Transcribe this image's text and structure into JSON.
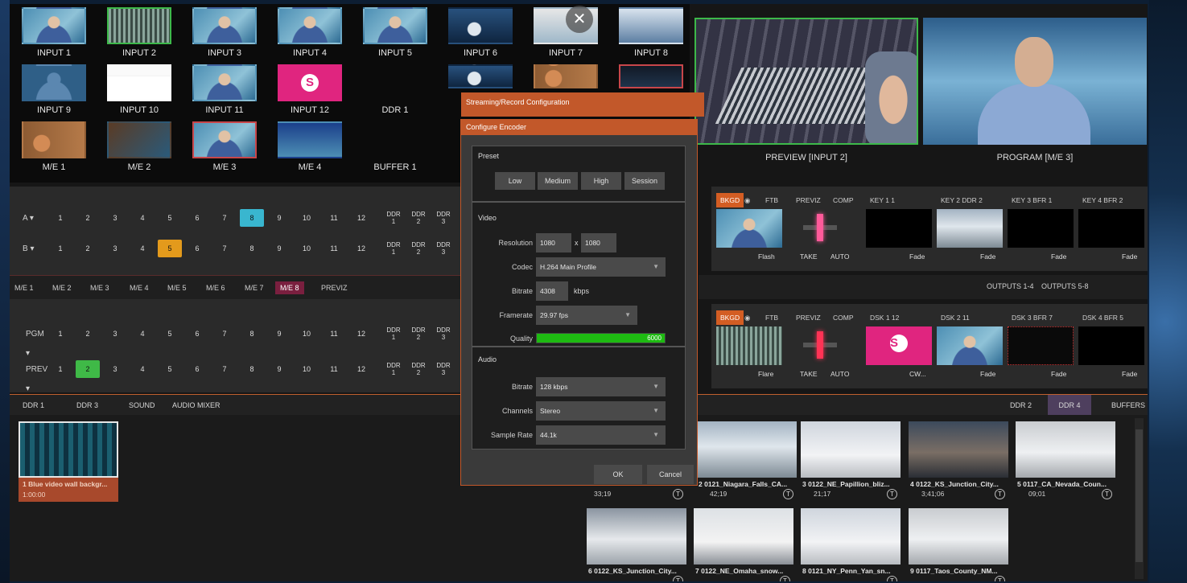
{
  "multiview": {
    "rows": [
      [
        "INPUT 1",
        "INPUT 2",
        "INPUT 3",
        "INPUT 4",
        "INPUT 5",
        "INPUT 6",
        "INPUT 7",
        "INPUT 8"
      ],
      [
        "INPUT 9",
        "INPUT 10",
        "INPUT 11",
        "INPUT 12",
        "DDR 1"
      ],
      [
        "M/E 1",
        "M/E 2",
        "M/E 3",
        "M/E 4",
        "BUFFER 1"
      ]
    ],
    "preview_label": "PREVIEW [INPUT 2]",
    "program_label": "PROGRAM [M/E 3]",
    "close_glyph": "✕"
  },
  "switcher": {
    "row_a_label": "A ▾",
    "row_b_label": "B ▾",
    "pgm_label": "PGM ▾",
    "prev_label": "PREV ▾",
    "buttons": [
      "1",
      "2",
      "3",
      "4",
      "5",
      "6",
      "7",
      "8",
      "9",
      "10",
      "11",
      "12"
    ],
    "ddr_buttons": [
      "DDR\n1",
      "DDR\n2",
      "DDR\n3"
    ],
    "me_tabs": [
      "M/E 1",
      "M/E 2",
      "M/E 3",
      "M/E 4",
      "M/E 5",
      "M/E 6",
      "M/E 7",
      "M/E 8",
      "PREVIZ"
    ],
    "outputs": [
      "OUTPUTS 1-4",
      "OUTPUTS 5-8"
    ]
  },
  "transition": {
    "top": {
      "bkgd": "BKGD",
      "ftb": "FTB",
      "previz": "PREVIZ",
      "comp": "COMP",
      "k1": "KEY 1   1",
      "k2": "KEY 2   DDR 2",
      "k3": "KEY 3   BFR 1",
      "k4": "KEY 4   BFR 2",
      "flash": "Flash",
      "take": "TAKE",
      "auto": "AUTO",
      "fade": "Fade"
    },
    "bot": {
      "bkgd": "BKGD",
      "ftb": "FTB",
      "previz": "PREVIZ",
      "comp": "COMP",
      "k1": "DSK 1   12",
      "k2": "DSK 2   11",
      "k3": "DSK 3   BFR 7",
      "k4": "DSK 4   BFR 5",
      "flash": "Flare",
      "take": "TAKE",
      "auto": "AUTO",
      "cw": "CW...",
      "fade": "Fade"
    }
  },
  "ddr": {
    "tabs_left": [
      "DDR 1",
      "DDR 3",
      "SOUND",
      "AUDIO MIXER"
    ],
    "tabs_right": [
      "DDR 2",
      "DDR 4",
      "BUFFERS"
    ],
    "selected_clip": {
      "name": "1  Blue video wall backgr...",
      "duration": "1:00:00"
    },
    "clips": [
      {
        "name": "2 0121_Niagara_Falls_CA...",
        "dur": "42;19"
      },
      {
        "name": "3 0122_NE_Papillion_bliz...",
        "dur": "21;17"
      },
      {
        "name": "4 0122_KS_Junction_City...",
        "dur": "3;41;06"
      },
      {
        "name": "5 0117_CA_Nevada_Coun...",
        "dur": "09;01"
      },
      {
        "name": "6 0122_KS_Junction_City...",
        "dur": ""
      },
      {
        "name": "7 0122_NE_Omaha_snow...",
        "dur": ""
      },
      {
        "name": "8 0121_NY_Penn_Yan_sn...",
        "dur": ""
      },
      {
        "name": "9 0117_Taos_County_NM...",
        "dur": ""
      }
    ],
    "partial_clip_dur": "33;19",
    "badge": "T"
  },
  "dialog": {
    "outer_title": "Streaming/Record Configuration",
    "title": "Configure Encoder",
    "preset_label": "Preset",
    "presets": [
      "Low",
      "Medium",
      "High",
      "Session"
    ],
    "video_label": "Video",
    "resolution_label": "Resolution",
    "res_w": "1080",
    "res_x": "x",
    "res_h": "1080",
    "codec_label": "Codec",
    "codec": "H.264 Main Profile",
    "bitrate_label": "Bitrate",
    "bitrate": "4308",
    "bitrate_unit": "kbps",
    "framerate_label": "Framerate",
    "framerate": "29.97 fps",
    "quality_label": "Quality",
    "quality_value": "6000",
    "audio_label": "Audio",
    "abitrate_label": "Bitrate",
    "abitrate": "128 kbps",
    "channels_label": "Channels",
    "channels": "Stereo",
    "samplerate_label": "Sample Rate",
    "samplerate": "44.1k",
    "ok": "OK",
    "cancel": "Cancel"
  }
}
